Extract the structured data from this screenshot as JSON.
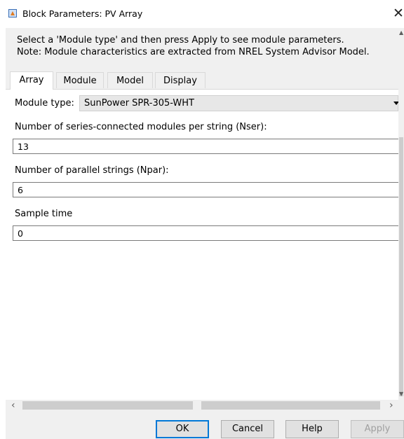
{
  "window": {
    "title": "Block Parameters: PV Array"
  },
  "description": {
    "line1": "Select a 'Module type' and then press Apply to see module parameters.",
    "line2": "Note: Module characteristics are extracted from NREL System Advisor Model."
  },
  "tabs": [
    {
      "label": "Array",
      "active": true
    },
    {
      "label": "Module",
      "active": false
    },
    {
      "label": "Model",
      "active": false
    },
    {
      "label": "Display",
      "active": false
    }
  ],
  "form": {
    "module_type_label": "Module type:",
    "module_type_value": "SunPower SPR-305-WHT",
    "nser_label": "Number of series-connected  modules per string (Nser):",
    "nser_value": "13",
    "npar_label": "Number of parallel strings (Npar):",
    "npar_value": "6",
    "sample_time_label": "Sample time",
    "sample_time_value": "0"
  },
  "buttons": {
    "ok": "OK",
    "cancel": "Cancel",
    "help": "Help",
    "apply": "Apply"
  },
  "icons": {
    "app": "block-parameters-icon",
    "close": "close-icon"
  }
}
